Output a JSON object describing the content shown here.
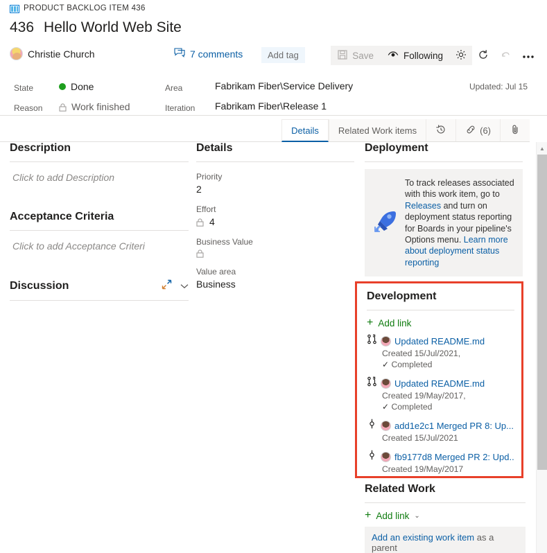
{
  "header": {
    "work_item_type": "PRODUCT BACKLOG ITEM 436",
    "backlog_icon": "backlog-board-icon",
    "id": "436",
    "title": "Hello World Web Site",
    "assigned_to": "Christie Church",
    "comments_label": "7 comments",
    "comments_icon": "comment-icon",
    "add_tag_label": "Add tag",
    "commands": {
      "save_label": "Save",
      "save_icon": "save-disk-icon",
      "follow_label": "Following",
      "follow_icon": "following-eye-icon",
      "gear_icon": "gear-icon",
      "refresh_icon": "refresh-icon",
      "undo_icon": "undo-icon",
      "more_icon": "more-ellipsis-icon"
    }
  },
  "fields": {
    "state_label": "State",
    "state_value": "Done",
    "state_color": "#1d9e1d",
    "reason_label": "Reason",
    "reason_value": "Work finished",
    "area_label": "Area",
    "area_value": "Fabrikam Fiber\\Service Delivery",
    "iteration_label": "Iteration",
    "iteration_value": "Fabrikam Fiber\\Release 1",
    "updated": "Updated: Jul 15"
  },
  "tabs": [
    {
      "label": "Details",
      "active": true
    },
    {
      "label": "Related Work items",
      "active": false
    },
    {
      "label": "",
      "icon": "history-clock-icon",
      "active": false
    },
    {
      "label": "(6)",
      "icon": "link-chain-icon",
      "active": false
    },
    {
      "label": "",
      "icon": "attachment-paperclip-icon",
      "active": false
    }
  ],
  "description": {
    "heading": "Description",
    "placeholder": "Click to add Description"
  },
  "acceptance_criteria": {
    "heading": "Acceptance Criteria",
    "placeholder": "Click to add Acceptance Criteri"
  },
  "discussion": {
    "heading": "Discussion",
    "expand_icon": "expand-diagonal-icon",
    "collapse_icon": "chevron-down-icon"
  },
  "details": {
    "heading": "Details",
    "fields": [
      {
        "label": "Priority",
        "value": "2",
        "locked": false
      },
      {
        "label": "Effort",
        "value": "4",
        "locked": true
      },
      {
        "label": "Business Value",
        "value": "",
        "locked": true
      },
      {
        "label": "Value area",
        "value": "Business",
        "locked": false
      }
    ]
  },
  "deployment": {
    "heading": "Deployment",
    "rocket_icon": "rocket-deploy-icon",
    "text_parts": [
      {
        "text": "To track releases associated with this work item, go to ",
        "link": false
      },
      {
        "text": "Releases",
        "link": true
      },
      {
        "text": " and turn on deployment status reporting for Boards in your pipeline's Options menu. ",
        "link": false
      },
      {
        "text": "Learn more about deployment status reporting",
        "link": true
      }
    ]
  },
  "development": {
    "heading": "Development",
    "add_link_label": "Add link",
    "highlight_color": "#e8402a",
    "items": [
      {
        "icon": "pull-request-icon",
        "title": "Updated README.md",
        "created": "Created 15/Jul/2021,",
        "status": "Completed",
        "status_icon": "checkmark-icon"
      },
      {
        "icon": "pull-request-icon",
        "title": "Updated README.md",
        "created": "Created 19/May/2017,",
        "status": "Completed",
        "status_icon": "checkmark-icon"
      },
      {
        "icon": "commit-icon",
        "title": "add1e2c1 Merged PR 8: Up...",
        "created": "Created 15/Jul/2021",
        "status": "",
        "status_icon": ""
      },
      {
        "icon": "commit-icon",
        "title": "fb9177d8 Merged PR 2: Upd...",
        "created": "Created 19/May/2017",
        "status": "",
        "status_icon": ""
      }
    ]
  },
  "related_work": {
    "heading": "Related Work",
    "add_link_label": "Add link",
    "chevron_icon": "chevron-down-icon",
    "action_link_text": "Add an existing work item",
    "action_suffix_text": " as a parent"
  },
  "scrollbar": {
    "up_arrow_icon": "scroll-up-arrow-icon"
  }
}
